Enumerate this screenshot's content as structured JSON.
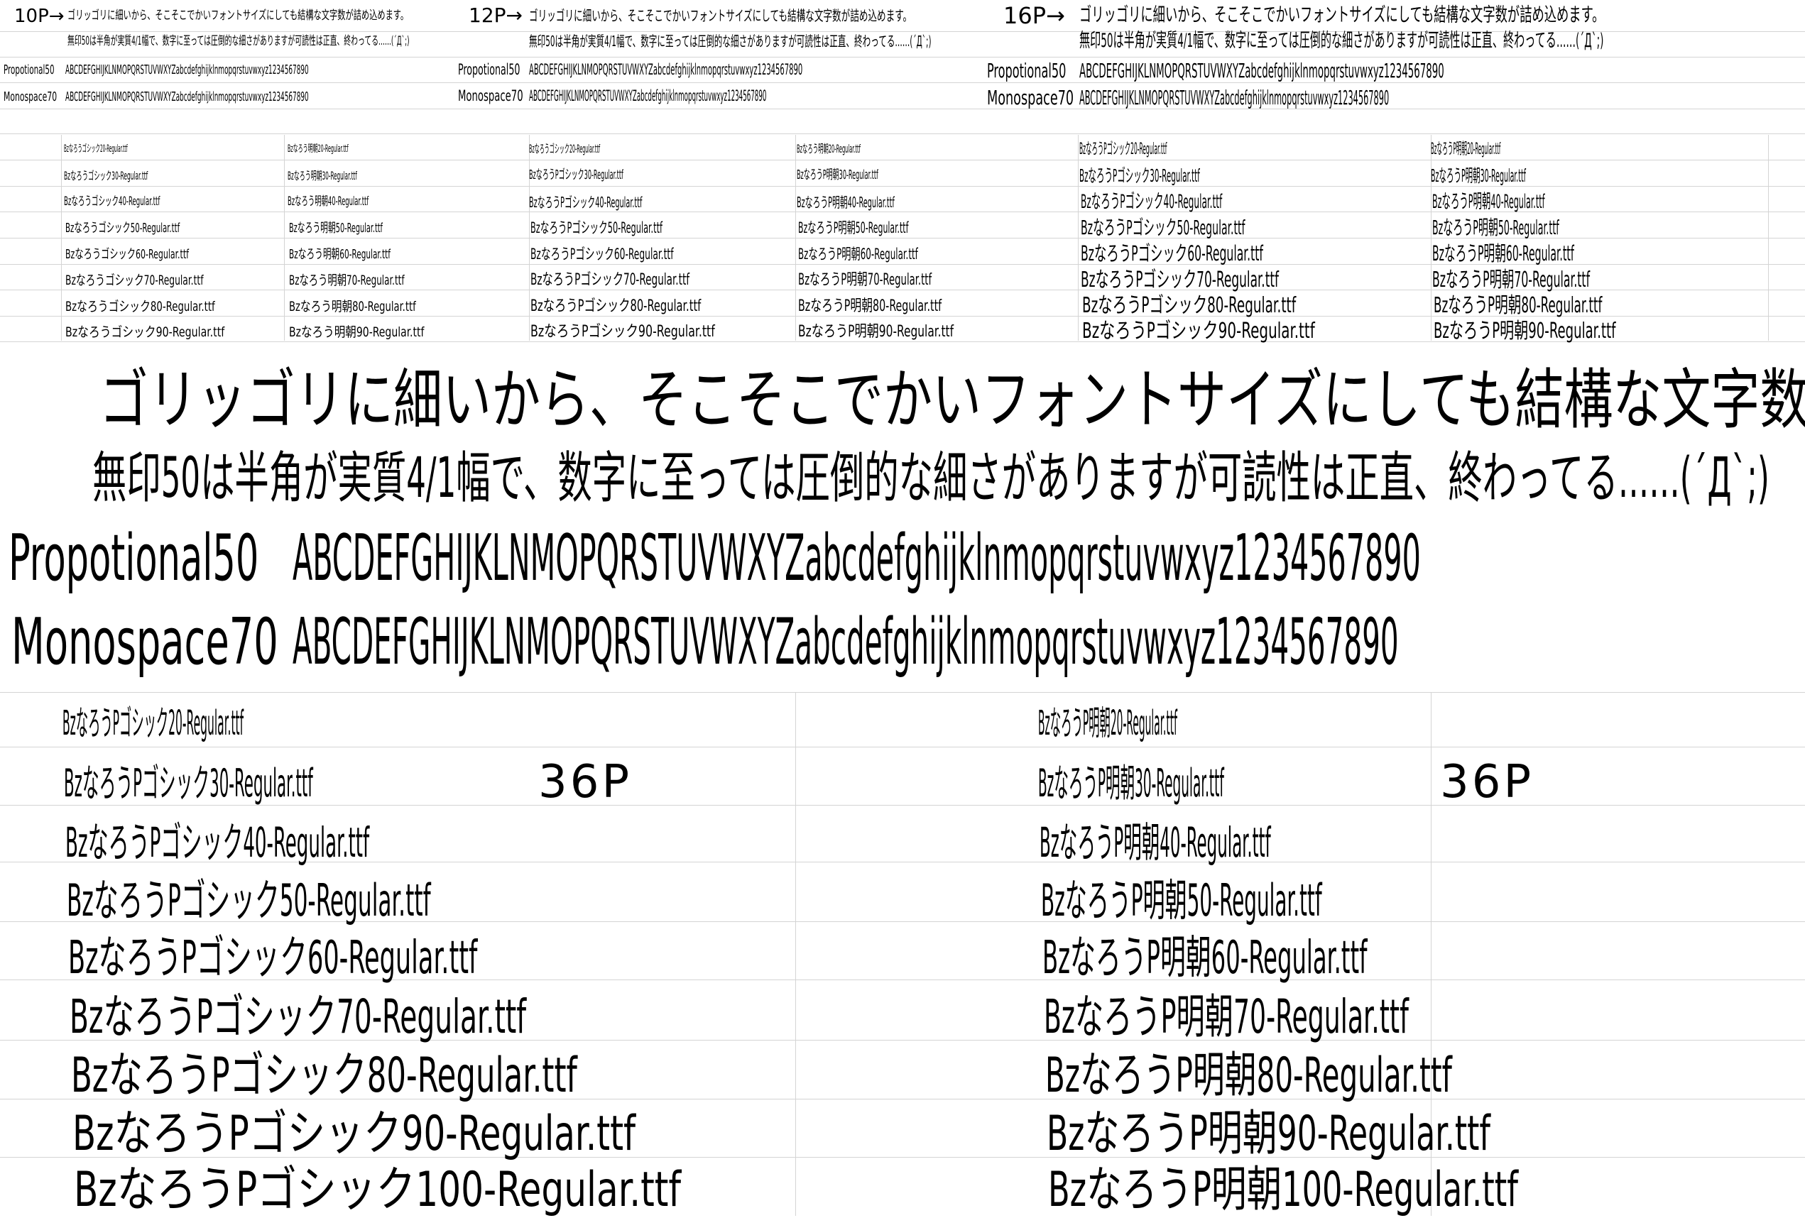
{
  "header": {
    "size_labels": [
      "10P→",
      "12P→",
      "16P→"
    ],
    "line1": "ゴリッゴリに細いから、そこそこでかいフォントサイズにしても結構な文字数が詰め込めます。",
    "line2": "無印50は半角が実質4/1幅で、数字に至っては圧倒的な細さがありますが可読性は正直、終わってる……(´Д`;)",
    "prop_label": "Propotional50",
    "mono_label": "Monospace70",
    "alphabet": "ABCDEFGHIJKLNMOPQRSTUVWXYZabcdefghijklnmopqrstuvwxyz1234567890",
    "mono_alphabet": "ABCDEFGHIJKLNMOPQRSTUVWXYZabcdefghijklnmopqrstuvwxyz1234567890"
  },
  "small_lists": {
    "gothic": [
      "Bzなろうゴシック20-Regular.ttf",
      "Bzなろうゴシック30-Regular.ttf",
      "Bzなろうゴシック40-Regular.ttf",
      "Bzなろうゴシック50-Regular.ttf",
      "Bzなろうゴシック60-Regular.ttf",
      "Bzなろうゴシック70-Regular.ttf",
      "Bzなろうゴシック80-Regular.ttf",
      "Bzなろうゴシック90-Regular.ttf"
    ],
    "mincho": [
      "Bzなろう明朝20-Regular.ttf",
      "Bzなろう明朝30-Regular.ttf",
      "Bzなろう明朝40-Regular.ttf",
      "Bzなろう明朝50-Regular.ttf",
      "Bzなろう明朝60-Regular.ttf",
      "Bzなろう明朝70-Regular.ttf",
      "Bzなろう明朝80-Regular.ttf",
      "Bzなろう明朝90-Regular.ttf"
    ],
    "gothic_p": [
      "Bzなろうゴシック20-Regular.ttf",
      "BzなろうPゴシック30-Regular.ttf",
      "BzなろうPゴシック40-Regular.ttf",
      "BzなろうPゴシック50-Regular.ttf",
      "BzなろうPゴシック60-Regular.ttf",
      "BzなろうPゴシック70-Regular.ttf",
      "BzなろうPゴシック80-Regular.ttf",
      "BzなろうPゴシック90-Regular.ttf"
    ],
    "mincho_p": [
      "Bzなろう明朝20-Regular.ttf",
      "BzなろうP明朝30-Regular.ttf",
      "BzなろうP明朝40-Regular.ttf",
      "BzなろうP明朝50-Regular.ttf",
      "BzなろうP明朝60-Regular.ttf",
      "BzなろうP明朝70-Regular.ttf",
      "BzなろうP明朝80-Regular.ttf",
      "BzなろうP明朝90-Regular.ttf"
    ],
    "gothic_p16": [
      "BzなろうPゴシック20-Regular.ttf",
      "BzなろうPゴシック30-Regular.ttf",
      "BzなろうPゴシック40-Regular.ttf",
      "BzなろうPゴシック50-Regular.ttf",
      "BzなろうPゴシック60-Regular.ttf",
      "BzなろうPゴシック70-Regular.ttf",
      "BzなろうPゴシック80-Regular.ttf",
      "BzなろうPゴシック90-Regular.ttf"
    ],
    "mincho_p16": [
      "BzなろうP明朝20-Regular.ttf",
      "BzなろうP明朝30-Regular.ttf",
      "BzなろうP明朝40-Regular.ttf",
      "BzなろうP明朝50-Regular.ttf",
      "BzなろうP明朝60-Regular.ttf",
      "BzなろうP明朝70-Regular.ttf",
      "BzなろうP明朝80-Regular.ttf",
      "BzなろうP明朝90-Regular.ttf"
    ]
  },
  "bottom": {
    "size_label": "36P",
    "gothic": [
      "BzなろうPゴシック20-Regular.ttf",
      "BzなろうPゴシック30-Regular.ttf",
      "BzなろうPゴシック40-Regular.ttf",
      "BzなろうPゴシック50-Regular.ttf",
      "BzなろうPゴシック60-Regular.ttf",
      "BzなろうPゴシック70-Regular.ttf",
      "BzなろうPゴシック80-Regular.ttf",
      "BzなろうPゴシック90-Regular.ttf",
      "BzなろうPゴシック100-Regular.ttf"
    ],
    "mincho": [
      "BzなろうP明朝20-Regular.ttf",
      "BzなろうP明朝30-Regular.ttf",
      "BzなろうP明朝40-Regular.ttf",
      "BzなろうP明朝50-Regular.ttf",
      "BzなろうP明朝60-Regular.ttf",
      "BzなろうP明朝70-Regular.ttf",
      "BzなろうP明朝80-Regular.ttf",
      "BzなろうP明朝90-Regular.ttf",
      "BzなろうP明朝100-Regular.ttf"
    ]
  }
}
